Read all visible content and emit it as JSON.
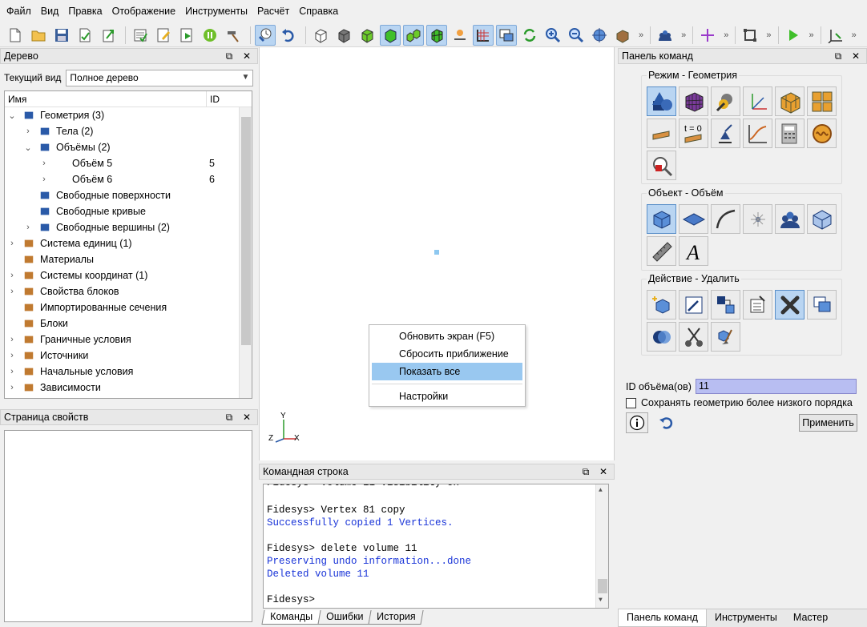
{
  "menu": [
    "Файл",
    "Вид",
    "Правка",
    "Отображение",
    "Инструменты",
    "Расчёт",
    "Справка"
  ],
  "tree_panel": {
    "title": "Дерево",
    "view_label": "Текущий вид",
    "view_value": "Полное дерево",
    "col_name": "Имя",
    "col_id": "ID",
    "rows": [
      {
        "label": "Геометрия (3)",
        "id": "",
        "icon": "geometry-icon",
        "arrow": "expanded"
      },
      {
        "label": "Тела (2)",
        "id": "",
        "icon": "body-icon",
        "arrow": "collapsed"
      },
      {
        "label": "Объёмы (2)",
        "id": "",
        "icon": "volume-icon",
        "arrow": "expanded"
      },
      {
        "label": "Объём 5",
        "id": "5",
        "icon": "",
        "arrow": "collapsed"
      },
      {
        "label": "Объём 6",
        "id": "6",
        "icon": "",
        "arrow": "collapsed"
      },
      {
        "label": "Свободные поверхности",
        "id": "",
        "icon": "surface-icon",
        "arrow": "none"
      },
      {
        "label": "Свободные кривые",
        "id": "",
        "icon": "curve-icon",
        "arrow": "none"
      },
      {
        "label": "Свободные вершины (2)",
        "id": "",
        "icon": "vertex-icon",
        "arrow": "collapsed"
      },
      {
        "label": "Система единиц (1)",
        "id": "",
        "icon": "units-icon",
        "arrow": "collapsed"
      },
      {
        "label": "Материалы",
        "id": "",
        "icon": "materials-icon",
        "arrow": "none"
      },
      {
        "label": "Системы координат (1)",
        "id": "",
        "icon": "coord-system-icon",
        "arrow": "collapsed"
      },
      {
        "label": "Свойства блоков",
        "id": "",
        "icon": "block-props-icon",
        "arrow": "collapsed"
      },
      {
        "label": "Импортированные сечения",
        "id": "",
        "icon": "imported-sections-icon",
        "arrow": "none"
      },
      {
        "label": "Блоки",
        "id": "",
        "icon": "blocks-icon",
        "arrow": "none"
      },
      {
        "label": "Граничные условия",
        "id": "",
        "icon": "boundary-conditions-icon",
        "arrow": "collapsed"
      },
      {
        "label": "Источники",
        "id": "",
        "icon": "sources-icon",
        "arrow": "collapsed"
      },
      {
        "label": "Начальные условия",
        "id": "",
        "icon": "initial-conditions-icon",
        "arrow": "collapsed"
      },
      {
        "label": "Зависимости",
        "id": "",
        "icon": "dependencies-icon",
        "arrow": "collapsed"
      }
    ]
  },
  "props_panel": {
    "title": "Страница свойств"
  },
  "viewport": {
    "axis_y": "Y",
    "axis_z": "Z",
    "axis_x": "X",
    "context_menu": [
      "Обновить экран (F5)",
      "Сбросить приближение",
      "Показать все",
      "Настройки"
    ]
  },
  "command_line": {
    "title": "Командная строка",
    "lines": [
      {
        "text": "Fidesys> Vertex 81 copy",
        "color": "black"
      },
      {
        "text": "Successfully copied 1 Vertices.",
        "color": "blue"
      },
      {
        "text": "",
        "color": "black"
      },
      {
        "text": "Fidesys> delete volume 11",
        "color": "black"
      },
      {
        "text": "Preserving undo information...done",
        "color": "blue"
      },
      {
        "text": "Deleted volume 11",
        "color": "blue"
      },
      {
        "text": "",
        "color": "black"
      },
      {
        "text": "Fidesys>",
        "color": "black"
      }
    ],
    "tabs": [
      "Команды",
      "Ошибки",
      "История"
    ]
  },
  "command_panel": {
    "title": "Панель команд",
    "mode_label": "Режим - Геометрия",
    "object_label": "Объект - Объём",
    "action_label": "Действие - Удалить",
    "id_label": "ID объёма(ов)",
    "id_value": "11",
    "keep_label": "Сохранять геометрию более низкого порядка",
    "apply_label": "Применить",
    "t0_text": "t = 0",
    "tabs": [
      "Панель команд",
      "Инструменты",
      "Мастер"
    ]
  },
  "colors": {
    "accent": "#b9d5f2",
    "highlight": "#99c8f0",
    "cmd_blue": "#1a35d8",
    "id_input": "#b8bef2"
  }
}
